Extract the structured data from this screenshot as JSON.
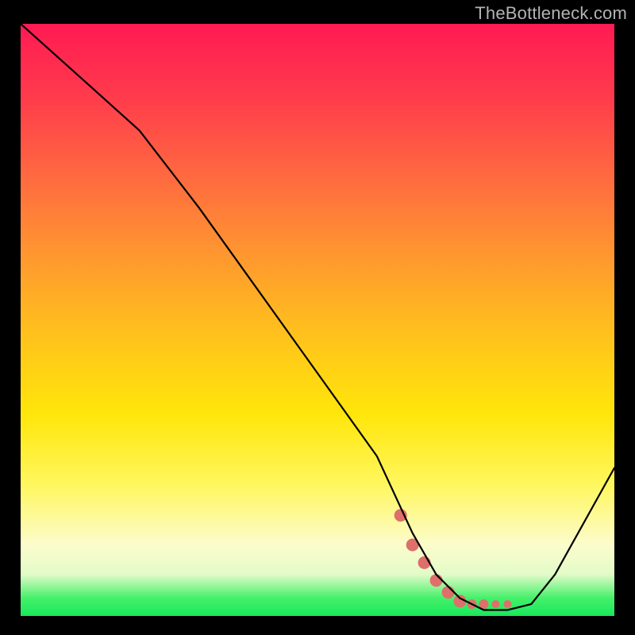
{
  "attribution": "TheBottleneck.com",
  "chart_data": {
    "type": "line",
    "title": "",
    "xlabel": "",
    "ylabel": "",
    "xlim": [
      0,
      100
    ],
    "ylim": [
      0,
      100
    ],
    "series": [
      {
        "name": "black-curve",
        "x": [
          0,
          10,
          20,
          30,
          40,
          50,
          60,
          66,
          70,
          74,
          78,
          82,
          86,
          90,
          100
        ],
        "values": [
          100,
          91,
          82,
          69,
          55,
          41,
          27,
          14,
          7,
          3,
          1,
          1,
          2,
          7,
          25
        ]
      }
    ],
    "markers": {
      "name": "salmon-highlight",
      "color": "#de6f6a",
      "x": [
        64,
        66,
        68,
        70,
        72,
        74,
        76,
        78,
        80,
        82
      ],
      "values": [
        17,
        12,
        9,
        6,
        4,
        2.5,
        2,
        2,
        2,
        2
      ],
      "sizes": [
        8,
        8,
        8,
        8,
        8,
        8,
        6,
        6,
        5,
        5
      ]
    },
    "background_gradient": {
      "top": "#ff1a53",
      "middle": "#ffe60a",
      "bottom": "#18e85c"
    }
  }
}
